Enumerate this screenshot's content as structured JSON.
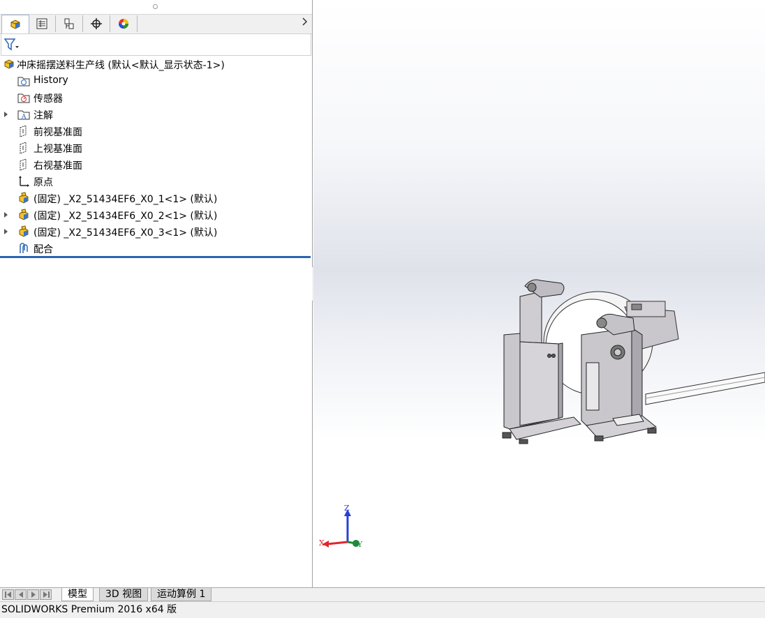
{
  "tree": {
    "root": "冲床摇摆送料生产线 (默认<默认_显示状态-1>)",
    "items": [
      {
        "label": "History"
      },
      {
        "label": "传感器"
      },
      {
        "label": "注解"
      },
      {
        "label": "前视基准面"
      },
      {
        "label": "上视基准面"
      },
      {
        "label": "右视基准面"
      },
      {
        "label": "原点"
      },
      {
        "label": "(固定) _X2_51434EF6_X0_1<1> (默认)"
      },
      {
        "label": "(固定) _X2_51434EF6_X0_2<1> (默认)"
      },
      {
        "label": "(固定) _X2_51434EF6_X0_3<1> (默认)"
      },
      {
        "label": "配合"
      }
    ]
  },
  "panel_tabs": [
    {
      "icon": "feature-manager-icon",
      "active": true
    },
    {
      "icon": "property-manager-icon"
    },
    {
      "icon": "configuration-manager-icon"
    },
    {
      "icon": "dimxpert-icon"
    },
    {
      "icon": "display-manager-icon"
    }
  ],
  "triad": {
    "x": "X",
    "y": "Y",
    "z": "Z"
  },
  "bottom_tabs": {
    "model": "模型",
    "view3d": "3D 视图",
    "motion": "运动算例 1"
  },
  "status": {
    "text": "SOLIDWORKS Premium 2016 x64 版"
  },
  "colors": {
    "accent": "#2b64b3",
    "assembly_yellow": "#f2c230",
    "part_gray": "#c9c6cc",
    "axis_x": "#e0262c",
    "axis_y": "#1f8a3a",
    "axis_z": "#2a3fd6"
  }
}
